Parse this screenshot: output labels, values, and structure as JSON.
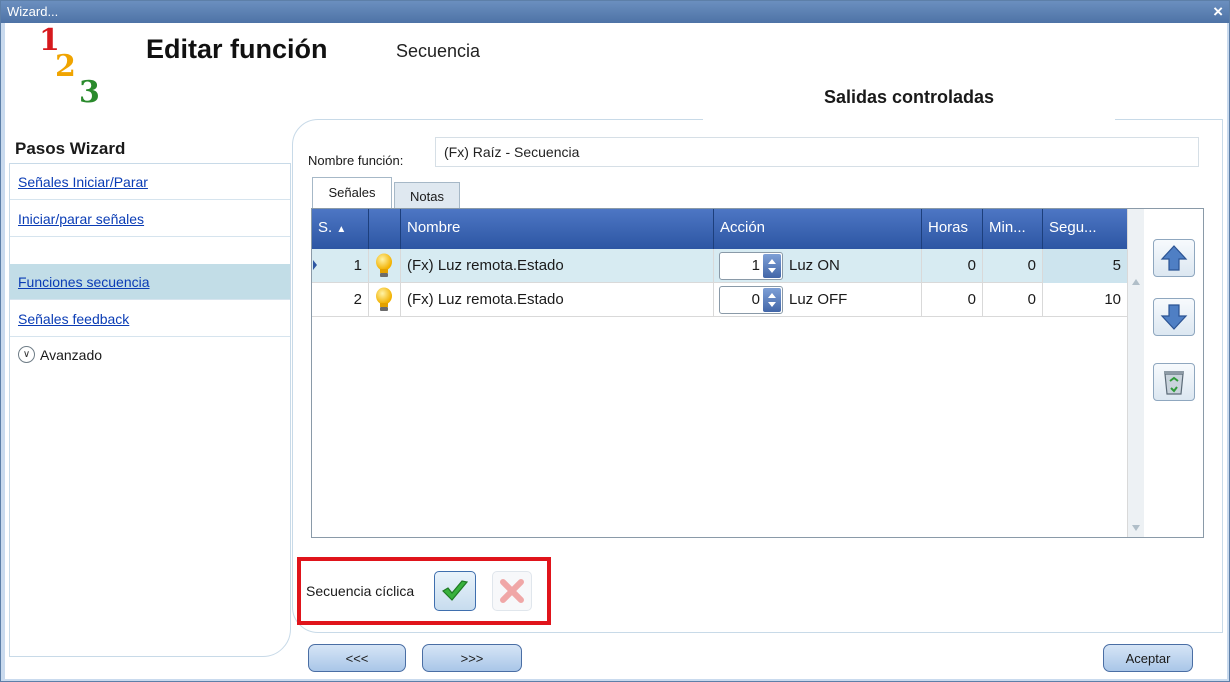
{
  "window": {
    "title": "Wizard...",
    "close_glyph": "×"
  },
  "header": {
    "logo_digits": [
      "1",
      "2",
      "3"
    ],
    "title": "Editar función",
    "subtitle": "Secuencia",
    "section_tab": "Salidas controladas"
  },
  "sidebar": {
    "heading": "Pasos Wizard",
    "items": [
      {
        "label": "Señales Iniciar/Parar",
        "active": false
      },
      {
        "label": "Iniciar/parar señales",
        "active": false
      },
      {
        "label": "Funciones secuencia",
        "active": true
      },
      {
        "label": "Señales feedback",
        "active": false
      }
    ],
    "advanced": {
      "label": "Avanzado",
      "icon": "chevron-down-icon"
    }
  },
  "main": {
    "name_label": "Nombre función:",
    "name_value": "(Fx) Raíz - Secuencia",
    "tabs": [
      {
        "label": "Señales",
        "active": true
      },
      {
        "label": "Notas",
        "active": false
      }
    ],
    "grid": {
      "columns": [
        "S.",
        "Nombre",
        "Acción",
        "Horas",
        "Min...",
        "Segu..."
      ],
      "sort_indicator": "▲",
      "rows": [
        {
          "s": "1",
          "icon": "lightbulb-icon",
          "nombre": "(Fx) Luz remota.Estado",
          "accion_value": "1",
          "accion_text": "Luz ON",
          "horas": "0",
          "min": "0",
          "seg": "5"
        },
        {
          "s": "2",
          "icon": "lightbulb-icon",
          "nombre": "(Fx) Luz remota.Estado",
          "accion_value": "0",
          "accion_text": "Luz OFF",
          "horas": "0",
          "min": "0",
          "seg": "10"
        }
      ]
    },
    "side_buttons": [
      "arrow-up-icon",
      "arrow-down-icon",
      "recycle-bin-icon"
    ],
    "cyclic": {
      "label": "Secuencia cíclica",
      "checked": true
    }
  },
  "footer": {
    "prev_label": "<<<",
    "next_label": ">>>",
    "accept_label": "Aceptar"
  },
  "colors": {
    "window_frame": "#c9daee",
    "grid_header": "#2d56a3",
    "selected_row": "#d7ebf2",
    "highlight_box": "#e0141b",
    "link": "#0a3cb5"
  }
}
